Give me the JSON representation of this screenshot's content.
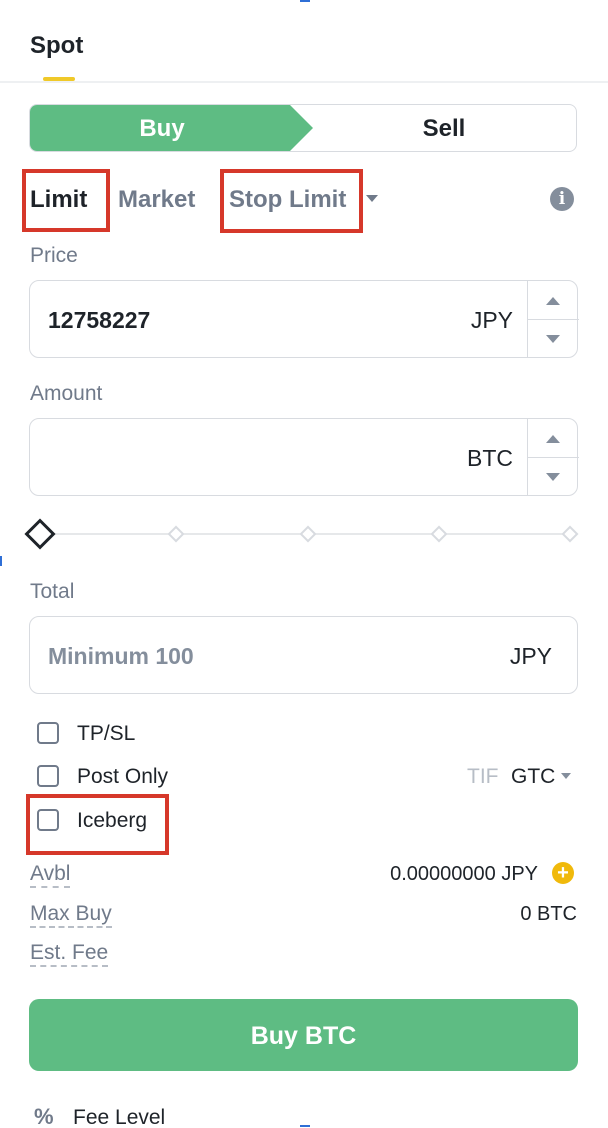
{
  "header": {
    "tab_label": "Spot"
  },
  "side_toggle": {
    "buy_label": "Buy",
    "sell_label": "Sell"
  },
  "order_types": {
    "limit": "Limit",
    "market": "Market",
    "stop_limit": "Stop Limit"
  },
  "price": {
    "label": "Price",
    "value": "12758227",
    "unit": "JPY"
  },
  "amount": {
    "label": "Amount",
    "value": "",
    "unit": "BTC"
  },
  "total": {
    "label": "Total",
    "placeholder": "Minimum 100",
    "unit": "JPY"
  },
  "slider": {
    "level": 0
  },
  "options": {
    "tpsl": "TP/SL",
    "post_only": "Post Only",
    "iceberg": "Iceberg",
    "tif_label": "TIF",
    "tif_value": "GTC"
  },
  "info": {
    "avbl_label": "Avbl",
    "avbl_value": "0.00000000 JPY",
    "max_buy_label": "Max Buy",
    "max_buy_value": "0 BTC",
    "est_fee_label": "Est. Fee"
  },
  "submit": {
    "label": "Buy BTC"
  },
  "footer": {
    "fee_icon": "%",
    "fee_level_label": "Fee Level"
  },
  "colors": {
    "buy_green": "#5ebc83",
    "highlight_red": "#d6382a",
    "tab_accent": "#f0c929",
    "plus_yellow": "#f0b90b"
  }
}
